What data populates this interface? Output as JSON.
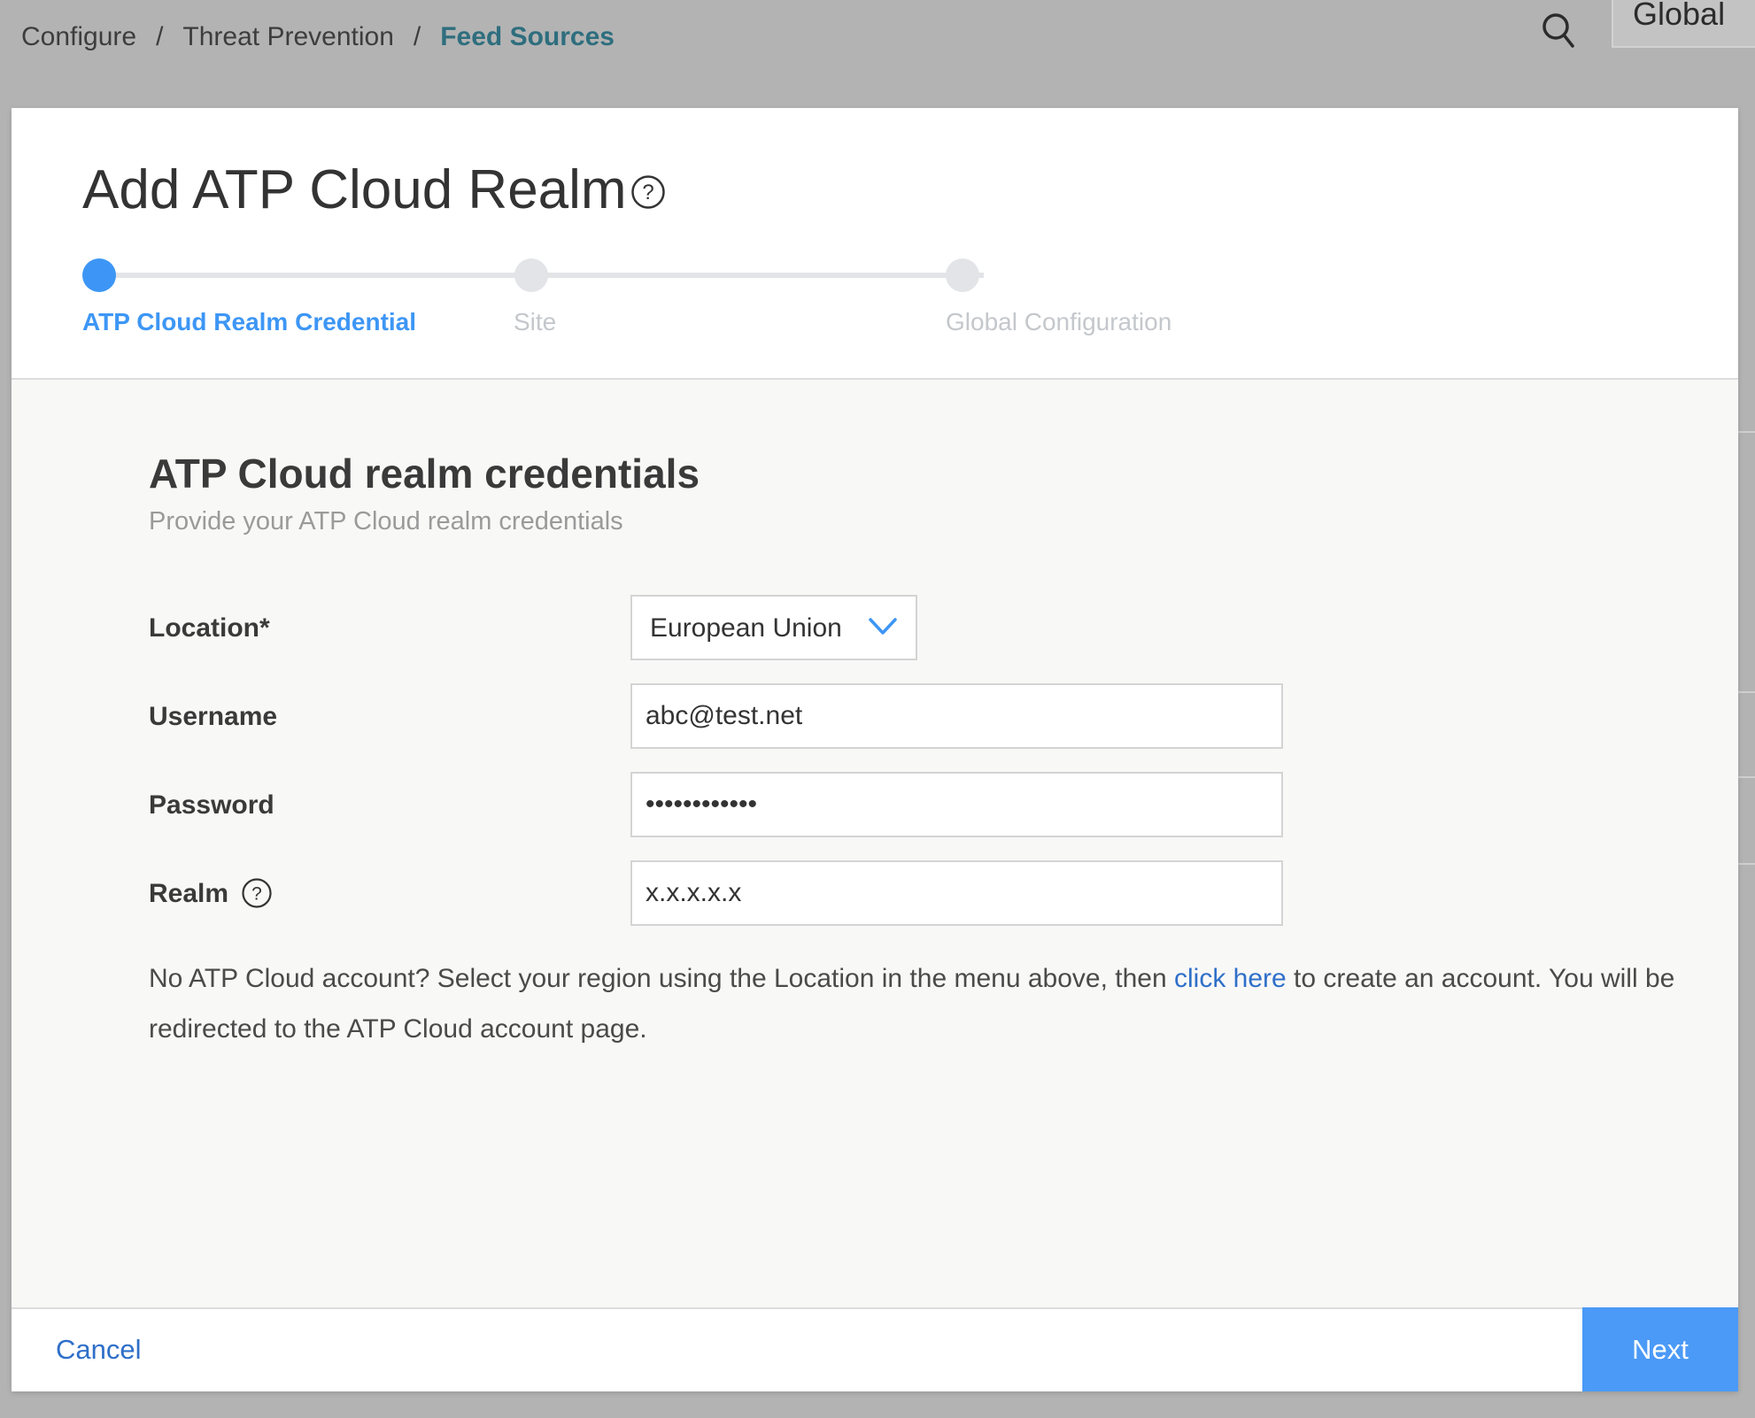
{
  "breadcrumb": {
    "items": [
      "Configure",
      "Threat Prevention"
    ],
    "current": "Feed Sources",
    "separator": "/"
  },
  "header": {
    "search_icon": "search-icon",
    "scope_label": "Global"
  },
  "modal": {
    "title": "Add ATP Cloud Realm",
    "title_help_icon": "help-circle-icon",
    "steps": [
      {
        "label": "ATP Cloud Realm Credential",
        "active": true
      },
      {
        "label": "Site",
        "active": false
      },
      {
        "label": "Global Configuration",
        "active": false
      }
    ],
    "section_title": "ATP Cloud realm credentials",
    "section_subtitle": "Provide your ATP Cloud realm credentials",
    "fields": {
      "location": {
        "label": "Location*",
        "value": "European Union"
      },
      "username": {
        "label": "Username",
        "value": "abc@test.net",
        "placeholder": ""
      },
      "password": {
        "label": "Password",
        "value": "••••••••••••"
      },
      "realm": {
        "label": "Realm",
        "value": "x.x.x.x.x",
        "help_icon": "help-circle-icon"
      }
    },
    "help_text": {
      "before_link": "No ATP Cloud account? Select your region using the Location in the menu above, then ",
      "link": "click here",
      "after_link": " to create an account. You will be redirected to the ATP Cloud account page."
    },
    "footer": {
      "cancel_label": "Cancel",
      "next_label": "Next"
    }
  },
  "colors": {
    "accent": "#3d96f5",
    "link": "#2f6fc9",
    "breadcrumb_current": "#2e6e7e",
    "next_button": "#4b9af7",
    "overlay": "#b3b3b3"
  }
}
